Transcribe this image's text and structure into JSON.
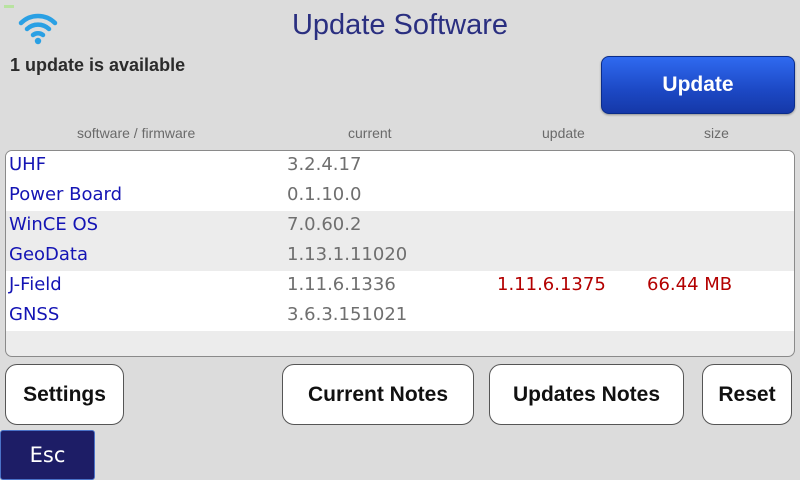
{
  "header": {
    "title": "Update Software",
    "status": "1 update is available",
    "wifi_icon": "wifi-icon"
  },
  "actions": {
    "update_label": "Update"
  },
  "table": {
    "columns": [
      "software / firmware",
      "current",
      "update",
      "size"
    ],
    "rows": [
      {
        "name": "UHF",
        "current": "3.2.4.17",
        "update": "",
        "size": ""
      },
      {
        "name": "Power Board",
        "current": "0.1.10.0",
        "update": "",
        "size": ""
      },
      {
        "name": "WinCE OS",
        "current": "7.0.60.2",
        "update": "",
        "size": ""
      },
      {
        "name": "GeoData",
        "current": "1.13.1.11020",
        "update": "",
        "size": ""
      },
      {
        "name": "J-Field",
        "current": "1.11.6.1336",
        "update": "1.11.6.1375",
        "size": "66.44 MB"
      },
      {
        "name": "GNSS",
        "current": "3.6.3.151021",
        "update": "",
        "size": ""
      }
    ]
  },
  "buttons": {
    "settings": "Settings",
    "current_notes": "Current Notes",
    "updates_notes": "Updates Notes",
    "reset": "Reset",
    "esc": "Esc"
  },
  "colors": {
    "background": "#dcdcdc",
    "title": "#2a2f80",
    "accent_blue": "#1c48c4",
    "name_text": "#1414b4",
    "update_text": "#b30000"
  }
}
